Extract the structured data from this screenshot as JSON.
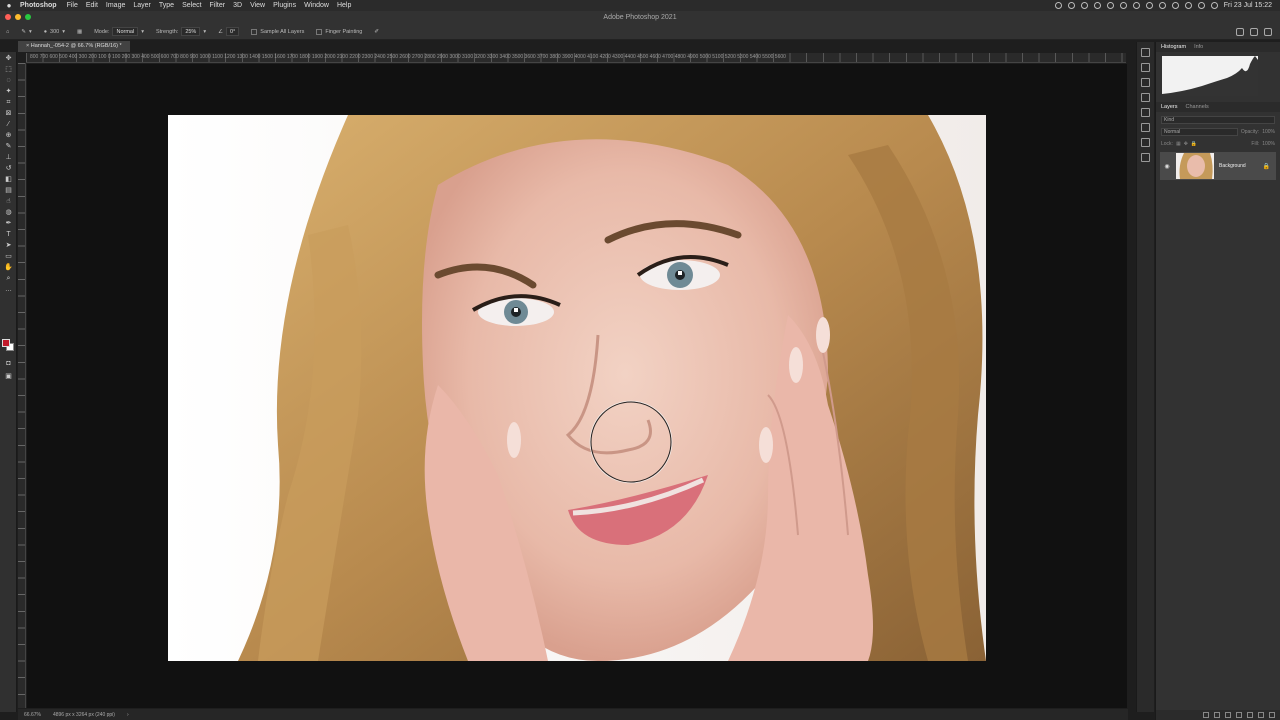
{
  "menubar": {
    "app": "Photoshop",
    "items": [
      "File",
      "Edit",
      "Image",
      "Layer",
      "Type",
      "Select",
      "Filter",
      "3D",
      "View",
      "Plugins",
      "Window",
      "Help"
    ],
    "clock": "Fri 23 Jul  15:22"
  },
  "window": {
    "title": "Adobe Photoshop 2021"
  },
  "options": {
    "brush_size": "300",
    "mode_label": "Mode:",
    "mode_value": "Normal",
    "strength_label": "Strength:",
    "strength_value": "25%",
    "angle_value": "0°",
    "sample_all_layers": "Sample All Layers",
    "finger_painting": "Finger Painting"
  },
  "document": {
    "tab": "Hannah_-054-2 @ 66.7% (RGB/16) *"
  },
  "ruler": {
    "labels": "800  700  600  500  400  300  200  100    0    100  200  300  400  500  600  700  800  900  1000 1100 1200 1300 1400 1500 1600 1700 1800 1900 2000 2100 2200 2300 2400 2500 2600 2700 2800 2900 3000 3100 3200 3300 3400 3500 3600 3700 3800 3900 4000 4100 4200 4300 4400 4500 4600 4700 4800 4900 5000 5100 5200 5300 5400 5500 5600"
  },
  "status": {
    "zoom": "66.67%",
    "dims": "4896 px x 3264 px (240 ppi)"
  },
  "panels": {
    "histogram_tab": "Histogram",
    "info_tab": "Info",
    "layers_tab": "Layers",
    "channels_tab": "Channels",
    "kind_placeholder": "Kind",
    "blend_mode": "Normal",
    "opacity_label": "Opacity:",
    "opacity_value": "100%",
    "lock_label": "Lock:",
    "fill_label": "Fill:",
    "fill_value": "100%",
    "layer_name": "Background"
  },
  "colors": {
    "foreground": "#c21a2b",
    "background": "#ffffff"
  }
}
